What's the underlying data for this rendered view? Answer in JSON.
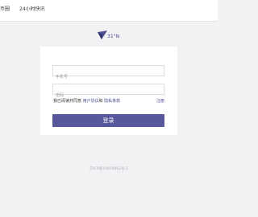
{
  "nav": {
    "items": [
      {
        "label": "币圈"
      },
      {
        "label": "24小时快讯"
      }
    ]
  },
  "logo": {
    "text": "31°N",
    "color": "#4b4f8c"
  },
  "login": {
    "phone_placeholder": "手机号",
    "password_placeholder": "密码",
    "agree_prefix": "我已阅读并同意",
    "user_agreement": "用户协议",
    "and": "和",
    "privacy_policy": "隐私条款",
    "register": "注册",
    "submit": "登录",
    "accent": "#56589b"
  },
  "footer": {
    "icp": "京ICP备18059862号-1"
  }
}
